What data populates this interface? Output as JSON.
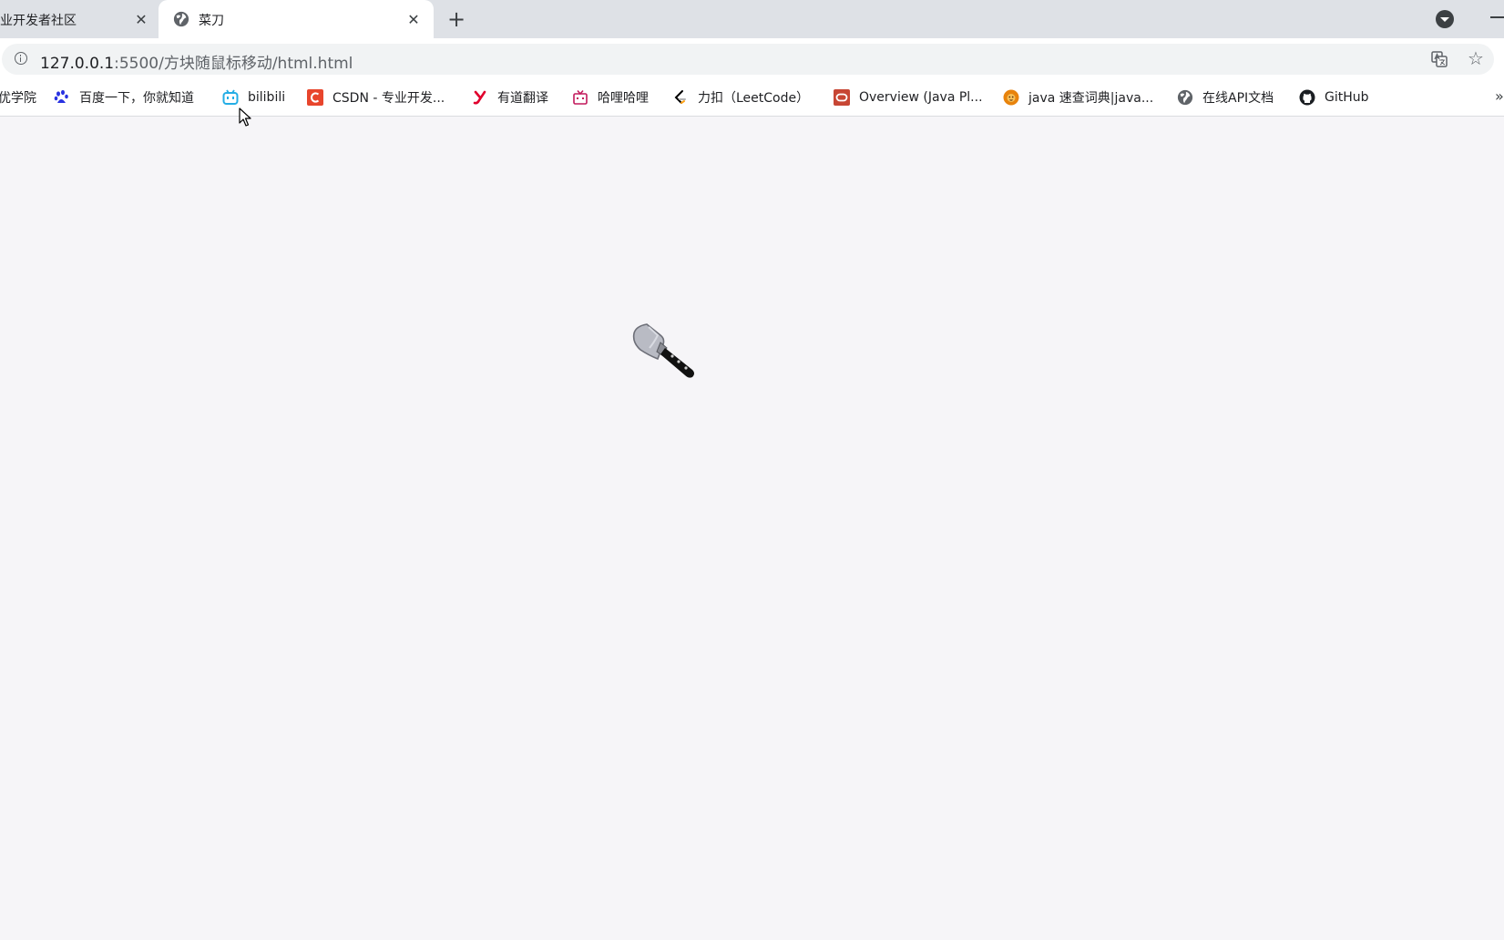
{
  "tabs": [
    {
      "label": "业开发者社区",
      "close": "✕",
      "active": false
    },
    {
      "label": "菜刀",
      "close": "✕",
      "active": true
    }
  ],
  "new_tab": "+",
  "address": {
    "host": "127.0.0.1",
    "path": ":5500/方块随鼠标移动/html.html"
  },
  "bookmarks": [
    {
      "label": "优学院",
      "icon": "none"
    },
    {
      "label": "百度一下，你就知道",
      "icon": "baidu-paw-icon"
    },
    {
      "label": "bilibili",
      "icon": "bilibili-tv-icon"
    },
    {
      "label": "CSDN - 专业开发...",
      "icon": "csdn-logo-icon"
    },
    {
      "label": "有道翻译",
      "icon": "youdao-logo-icon"
    },
    {
      "label": "哈哩哈哩",
      "icon": "tv-icon"
    },
    {
      "label": "力扣（LeetCode）",
      "icon": "leetcode-logo-icon"
    },
    {
      "label": "Overview (Java Pl...",
      "icon": "oracle-logo-icon"
    },
    {
      "label": "java 速查词典|java...",
      "icon": "lion-logo-icon"
    },
    {
      "label": "在线API文档",
      "icon": "globe-icon"
    },
    {
      "label": "GitHub",
      "icon": "github-logo-icon"
    }
  ],
  "bookmarks_more": "»",
  "colors": {
    "page_bg": "#f6f5f8",
    "tabstrip_bg": "#dee1e6",
    "omnibox_bg": "#f1f3f4"
  }
}
